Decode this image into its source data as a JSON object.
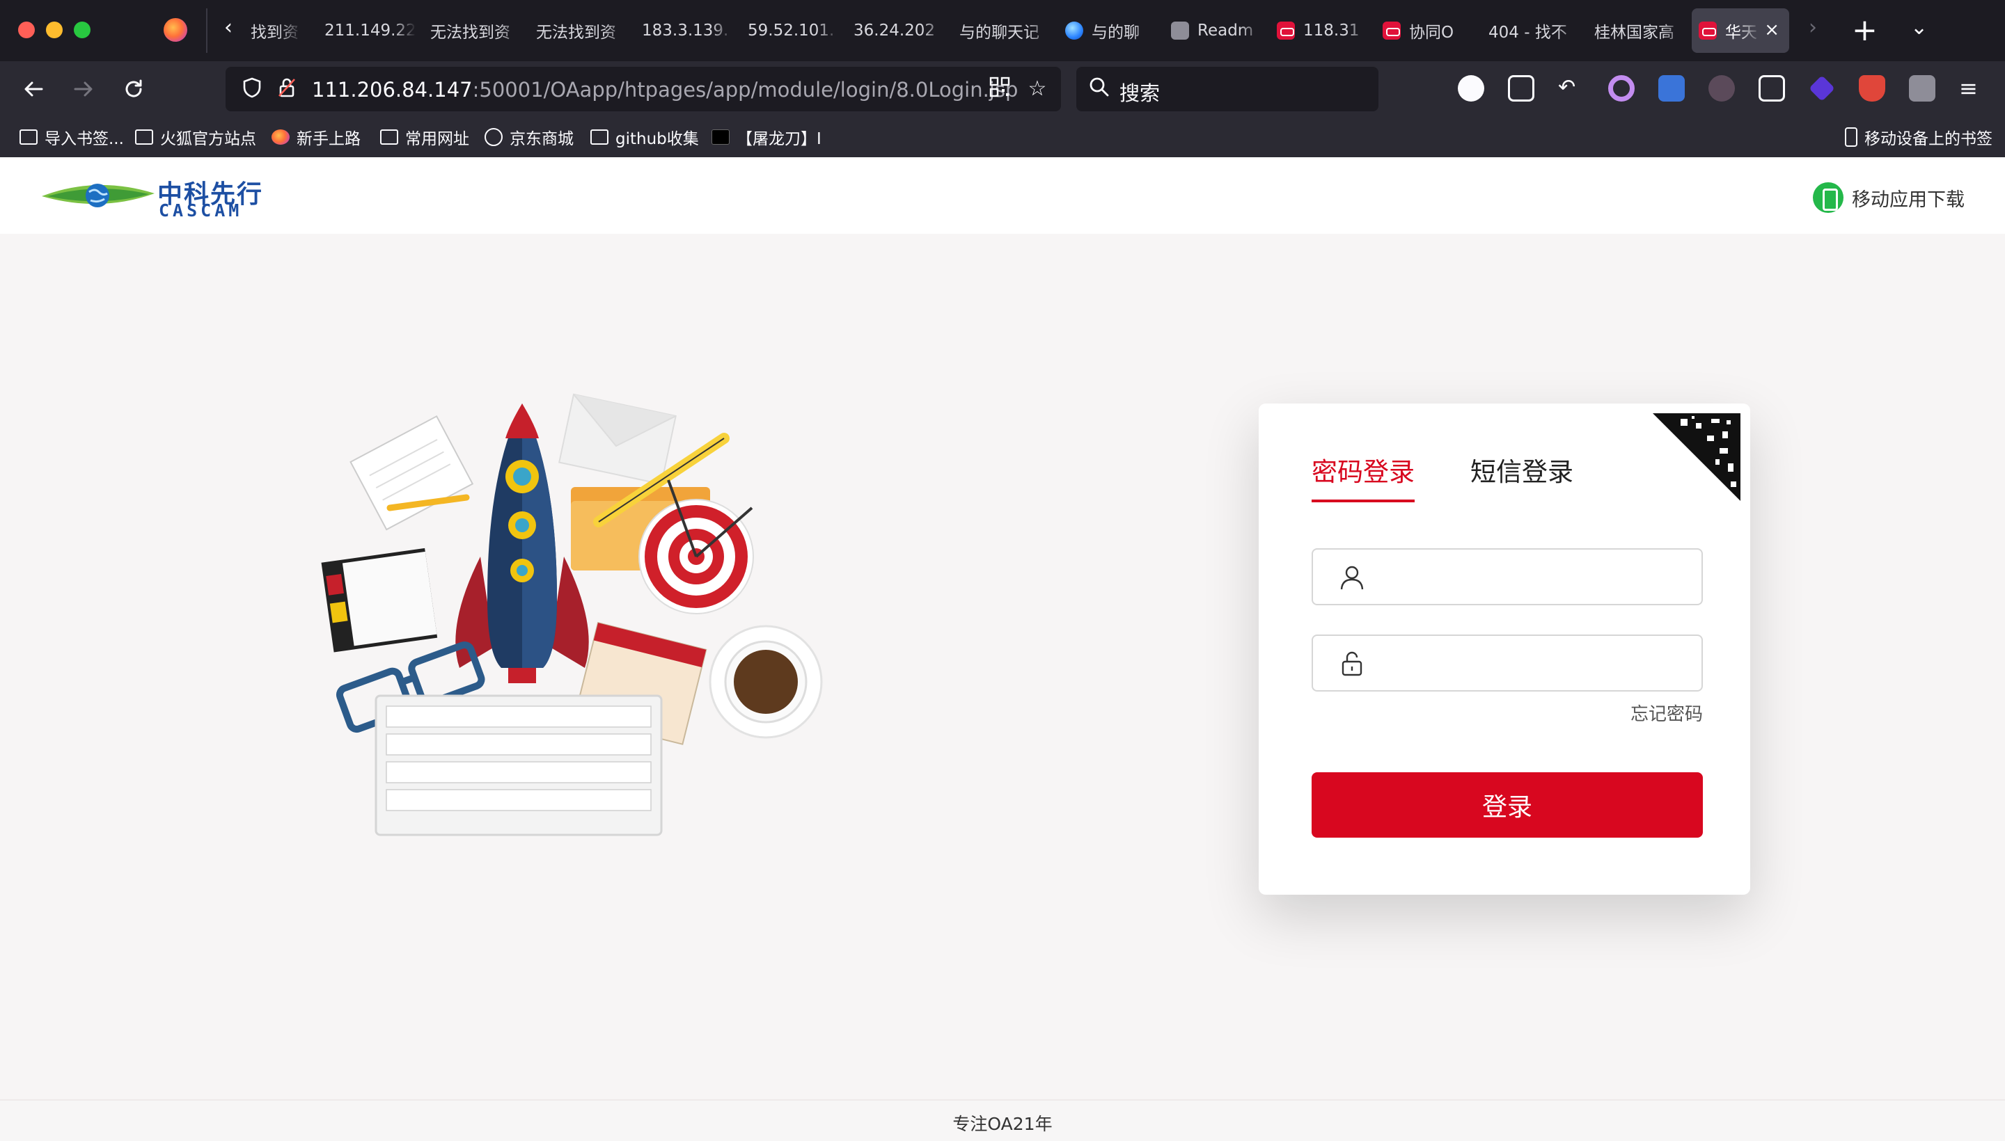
{
  "browser": {
    "tabs": [
      {
        "label": "找到资",
        "icon": "none"
      },
      {
        "label": "211.149.22",
        "icon": "none"
      },
      {
        "label": "无法找到资",
        "icon": "none"
      },
      {
        "label": "无法找到资",
        "icon": "none"
      },
      {
        "label": "183.3.139.",
        "icon": "none"
      },
      {
        "label": "59.52.101.",
        "icon": "none"
      },
      {
        "label": "36.24.202",
        "icon": "none"
      },
      {
        "label": "与的聊天记",
        "icon": "none"
      },
      {
        "label": "与的聊",
        "icon": "globe-icon"
      },
      {
        "label": "Readm",
        "icon": "grey-icon"
      },
      {
        "label": "118.31",
        "icon": "mask-icon"
      },
      {
        "label": "协同O",
        "icon": "mask-icon"
      },
      {
        "label": "404 - 找不",
        "icon": "none"
      },
      {
        "label": "桂林国家高",
        "icon": "none"
      },
      {
        "label": "华天",
        "icon": "mask-icon",
        "active": true
      }
    ],
    "url_host": "111.206.84.147",
    "url_path": ":50001/OAapp/htpages/app/module/login/8.0Login.jsp",
    "search_placeholder": "搜索",
    "bookmarks": [
      {
        "label": "导入书签...",
        "icon": "import-icon"
      },
      {
        "label": "火狐官方站点",
        "icon": "folder-icon"
      },
      {
        "label": "新手上路",
        "icon": "firefox-icon"
      },
      {
        "label": "常用网址",
        "icon": "folder-icon"
      },
      {
        "label": "京东商城",
        "icon": "globe-icon"
      },
      {
        "label": "github收集",
        "icon": "folder-icon"
      },
      {
        "label": "【屠龙刀】I",
        "icon": "dark-icon"
      }
    ],
    "mobile_bookmarks": "移动设备上的书签",
    "colors": {
      "chrome": "#2b2a33",
      "tabbar": "#1c1b22",
      "active_tab": "#42414d"
    }
  },
  "header": {
    "logo_cn": "中科先行",
    "logo_en": "CASCAM",
    "mobile_download": "移动应用下载"
  },
  "login": {
    "tab_password": "密码登录",
    "tab_sms": "短信登录",
    "username_value": "",
    "password_value": "",
    "forgot_password": "忘记密码",
    "submit": "登录",
    "accent_color": "#d8071f"
  },
  "footer": {
    "text": "专注OA21年"
  }
}
